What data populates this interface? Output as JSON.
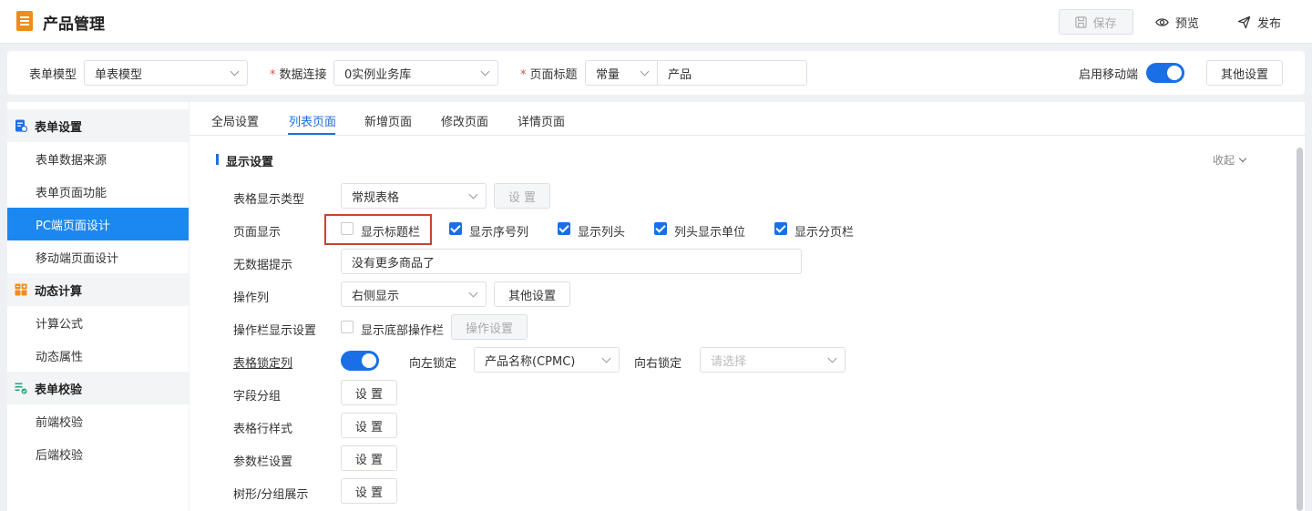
{
  "header": {
    "title": "产品管理",
    "save_label": "保存",
    "preview_label": "预览",
    "publish_label": "发布"
  },
  "toolbar": {
    "form_model_label": "表单模型",
    "form_model_value": "单表模型",
    "data_conn_label": "数据连接",
    "data_conn_value": "0实例业务库",
    "page_title_label": "页面标题",
    "page_title_type": "常量",
    "page_title_value": "产品",
    "mobile_label": "启用移动端",
    "mobile_enabled": true,
    "other_settings_label": "其他设置",
    "required_mark": "*"
  },
  "sidebar": {
    "groups": [
      {
        "label": "表单设置",
        "items": [
          "表单数据来源",
          "表单页面功能",
          "PC端页面设计",
          "移动端页面设计"
        ]
      },
      {
        "label": "动态计算",
        "items": [
          "计算公式",
          "动态属性"
        ]
      },
      {
        "label": "表单校验",
        "items": [
          "前端校验",
          "后端校验"
        ]
      }
    ],
    "active_item": "PC端页面设计"
  },
  "tabs": [
    "全局设置",
    "列表页面",
    "新增页面",
    "修改页面",
    "详情页面"
  ],
  "active_tab": "列表页面",
  "section": {
    "title": "显示设置",
    "collapse_label": "收起"
  },
  "form": {
    "table_type_label": "表格显示类型",
    "table_type_value": "常规表格",
    "table_type_btn": "设 置",
    "page_display_label": "页面显示",
    "page_display_options": [
      {
        "label": "显示标题栏",
        "checked": false
      },
      {
        "label": "显示序号列",
        "checked": true
      },
      {
        "label": "显示列头",
        "checked": true
      },
      {
        "label": "列头显示单位",
        "checked": true
      },
      {
        "label": "显示分页栏",
        "checked": true
      }
    ],
    "no_data_label": "无数据提示",
    "no_data_value": "没有更多商品了",
    "op_col_label": "操作列",
    "op_col_value": "右侧显示",
    "op_col_btn": "其他设置",
    "op_bar_label": "操作栏显示设置",
    "op_bar_check_label": "显示底部操作栏",
    "op_bar_checked": false,
    "op_bar_btn": "操作设置",
    "lock_col_label": "表格锁定列",
    "lock_col_enabled": true,
    "lock_left_label": "向左锁定",
    "lock_left_value": "产品名称(CPMC)",
    "lock_right_label": "向右锁定",
    "lock_right_placeholder": "请选择",
    "field_group_label": "字段分组",
    "row_style_label": "表格行样式",
    "param_bar_label": "参数栏设置",
    "tree_group_label": "树形/分组展示",
    "set_btn": "设 置"
  },
  "colors": {
    "accent": "#1a6fe6",
    "active_nav": "#1a88f0",
    "highlight_border": "#c8432f",
    "app_icon": "#f08c1a"
  }
}
